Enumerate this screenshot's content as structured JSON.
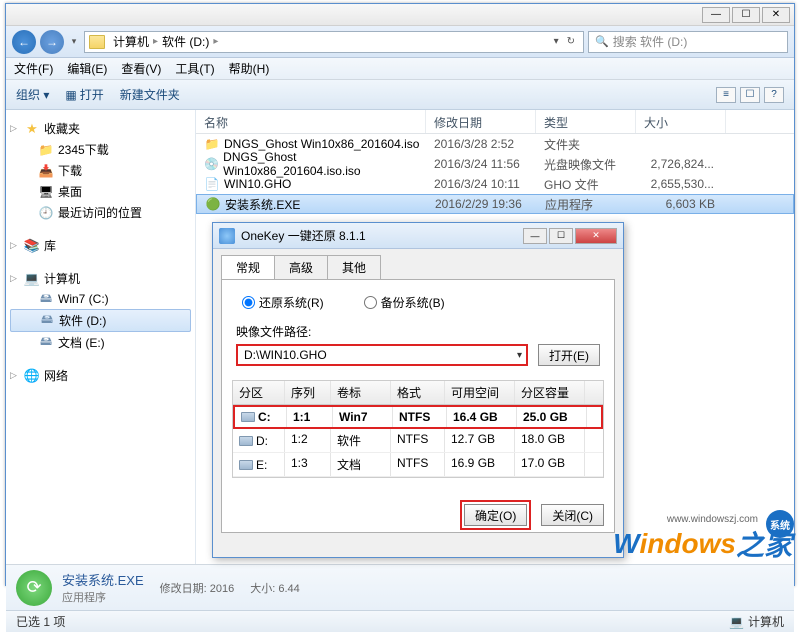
{
  "titlebar": {
    "min": "—",
    "max": "☐",
    "close": "✕"
  },
  "nav": {
    "crumbs": [
      "计算机",
      "软件 (D:)"
    ],
    "search_placeholder": "搜索 软件 (D:)"
  },
  "menu": {
    "file": "文件(F)",
    "edit": "编辑(E)",
    "view": "查看(V)",
    "tools": "工具(T)",
    "help": "帮助(H)"
  },
  "toolbar": {
    "organize": "组织 ▾",
    "open": "打开",
    "newfolder": "新建文件夹"
  },
  "sidebar": {
    "favorites": {
      "label": "收藏夹",
      "items": [
        "2345下载",
        "下载",
        "桌面",
        "最近访问的位置"
      ]
    },
    "libraries": {
      "label": "库"
    },
    "computer": {
      "label": "计算机",
      "items": [
        "Win7 (C:)",
        "软件 (D:)",
        "文档 (E:)"
      ]
    },
    "network": {
      "label": "网络"
    }
  },
  "fileheader": {
    "name": "名称",
    "date": "修改日期",
    "type": "类型",
    "size": "大小"
  },
  "files": [
    {
      "icon": "📁",
      "name": "DNGS_Ghost Win10x86_201604.iso",
      "date": "2016/3/28 2:52",
      "type": "文件夹",
      "size": ""
    },
    {
      "icon": "💿",
      "name": "DNGS_Ghost Win10x86_201604.iso.iso",
      "date": "2016/3/24 11:56",
      "type": "光盘映像文件",
      "size": "2,726,824..."
    },
    {
      "icon": "📄",
      "name": "WIN10.GHO",
      "date": "2016/3/24 10:11",
      "type": "GHO 文件",
      "size": "2,655,530..."
    },
    {
      "icon": "🟢",
      "name": "安装系统.EXE",
      "date": "2016/2/29 19:36",
      "type": "应用程序",
      "size": "6,603 KB",
      "selected": true
    }
  ],
  "detail": {
    "name": "安装系统.EXE",
    "type": "应用程序",
    "date_label": "修改日期:",
    "date": "2016",
    "size_label": "大小:",
    "size": "6.44"
  },
  "status": {
    "left": "已选 1 项",
    "right": "计算机"
  },
  "dialog": {
    "title": "OneKey 一键还原 8.1.1",
    "tabs": [
      "常规",
      "高级",
      "其他"
    ],
    "radio_restore": "还原系统(R)",
    "radio_backup": "备份系统(B)",
    "path_label": "映像文件路径:",
    "path_value": "D:\\WIN10.GHO",
    "open_btn": "打开(E)",
    "ptable_header": [
      "分区",
      "序列",
      "卷标",
      "格式",
      "可用空间",
      "分区容量"
    ],
    "partitions": [
      {
        "drive": "C:",
        "seq": "1:1",
        "label": "Win7",
        "fs": "NTFS",
        "free": "16.4 GB",
        "cap": "25.0 GB",
        "hl": true
      },
      {
        "drive": "D:",
        "seq": "1:2",
        "label": "软件",
        "fs": "NTFS",
        "free": "12.7 GB",
        "cap": "18.0 GB"
      },
      {
        "drive": "E:",
        "seq": "1:3",
        "label": "文档",
        "fs": "NTFS",
        "free": "16.9 GB",
        "cap": "17.0 GB"
      }
    ],
    "ok": "确定(O)",
    "close": "关闭(C)"
  },
  "watermark": {
    "url": "www.windowszj.com",
    "badge": "系统",
    "t1": "W",
    "t2": "indows",
    "t3": "之家"
  }
}
